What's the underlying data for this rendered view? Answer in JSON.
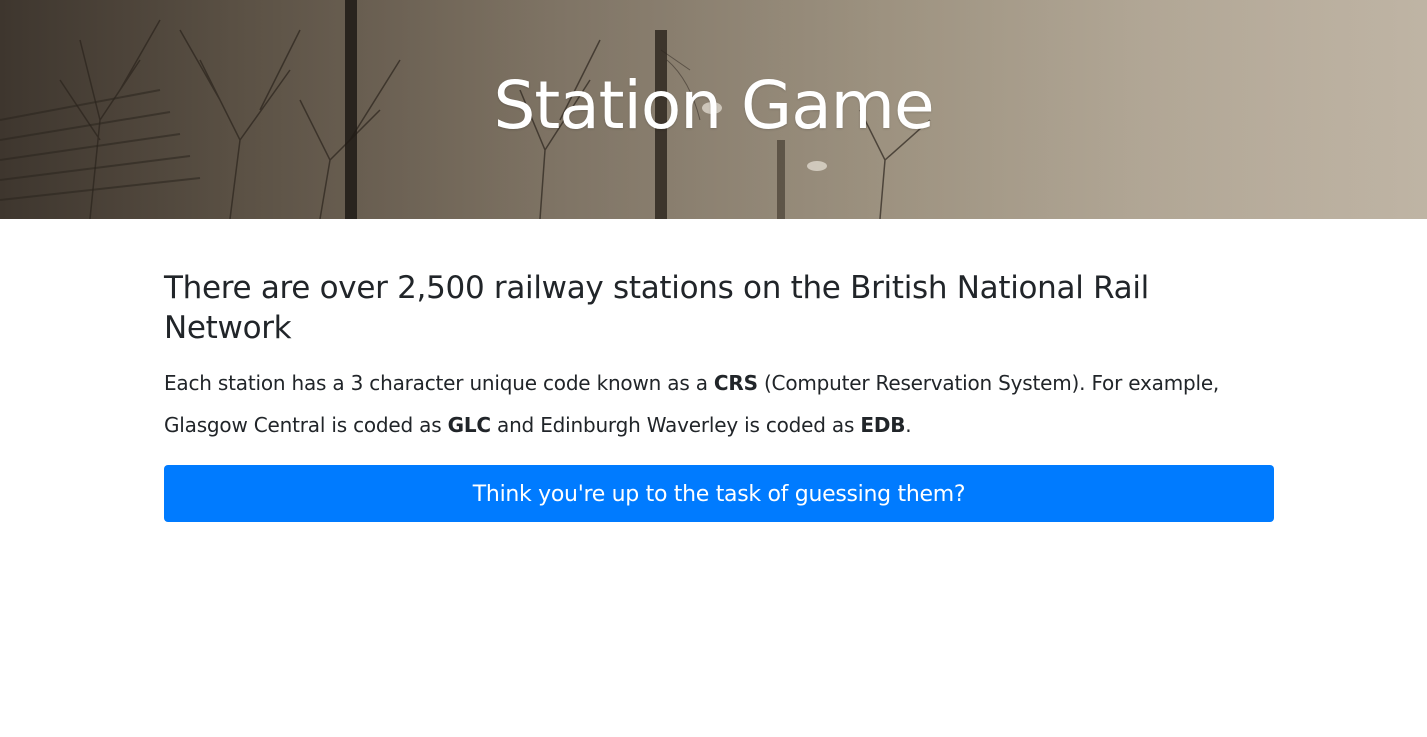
{
  "hero": {
    "title": "Station Game"
  },
  "main": {
    "heading": "There are over 2,500 railway stations on the British National Rail Network",
    "intro": {
      "part1": "Each station has a 3 character unique code known as a ",
      "crs": "CRS",
      "part2": " (Computer Reservation System). For example, Glasgow Central is coded as ",
      "glc": "GLC",
      "part3": " and Edinburgh Waverley is coded as ",
      "edb": "EDB",
      "part4": "."
    },
    "cta_label": "Think you're up to the task of guessing them?"
  },
  "colors": {
    "accent": "#007bff",
    "text": "#212529",
    "hero_overlay": "#8a7f70"
  }
}
